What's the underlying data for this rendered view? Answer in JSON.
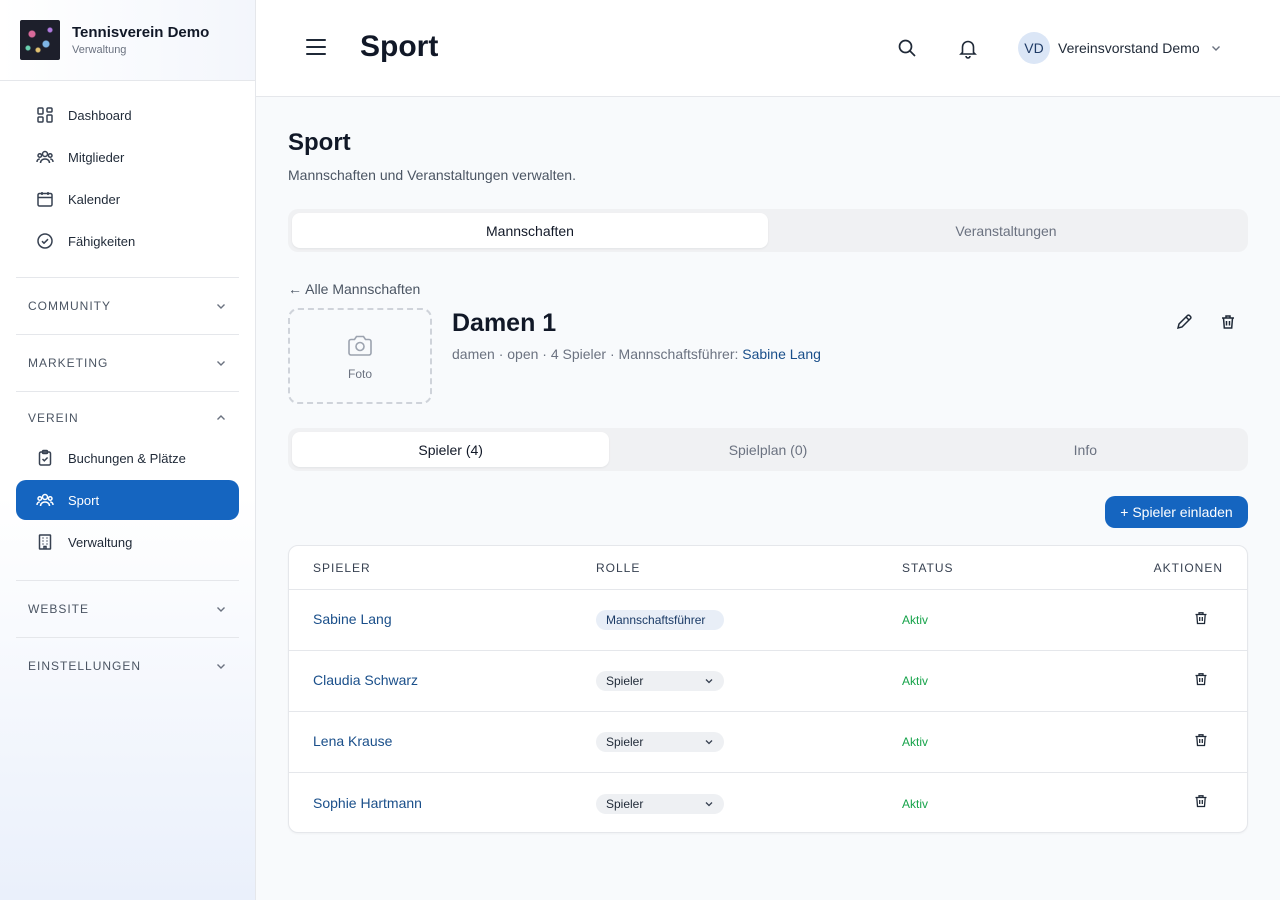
{
  "brand": {
    "name": "Tennisverein Demo",
    "subtitle": "Verwaltung"
  },
  "nav_main": [
    {
      "label": "Dashboard",
      "icon": "dashboard-icon"
    },
    {
      "label": "Mitglieder",
      "icon": "users-icon"
    },
    {
      "label": "Kalender",
      "icon": "calendar-icon"
    },
    {
      "label": "Fähigkeiten",
      "icon": "check-circle-icon"
    }
  ],
  "sections": {
    "community": "COMMUNITY",
    "marketing": "MARKETING",
    "verein": "VEREIN",
    "website": "WEBSITE",
    "einstellungen": "EINSTELLUNGEN"
  },
  "verein_items": [
    {
      "label": "Buchungen & Plätze",
      "icon": "clipboard-check-icon"
    },
    {
      "label": "Sport",
      "icon": "users-icon",
      "active": true
    },
    {
      "label": "Verwaltung",
      "icon": "building-icon"
    }
  ],
  "header": {
    "title": "Sport",
    "user_initials": "VD",
    "user_name": "Vereinsvorstand Demo"
  },
  "page": {
    "title": "Sport",
    "description": "Mannschaften und Veranstaltungen verwalten.",
    "tabs": [
      "Mannschaften",
      "Veranstaltungen"
    ],
    "active_tab": 0,
    "back_label": "← Alle Mannschaften"
  },
  "team": {
    "photo_label": "Foto",
    "name": "Damen 1",
    "meta_prefix": "damen · open · 4 Spieler · Mannschaftsführer: ",
    "captain": "Sabine Lang",
    "subtabs": [
      "Spieler (4)",
      "Spielplan (0)",
      "Info"
    ],
    "active_subtab": 0
  },
  "invite_button": "+ Spieler einladen",
  "table": {
    "headers": {
      "player": "SPIELER",
      "role": "ROLLE",
      "status": "STATUS",
      "actions": "AKTIONEN"
    },
    "rows": [
      {
        "player": "Sabine Lang",
        "role": "Mannschaftsführer",
        "status": "Aktiv"
      },
      {
        "player": "Claudia Schwarz",
        "role": "Spieler",
        "status": "Aktiv"
      },
      {
        "player": "Lena Krause",
        "role": "Spieler",
        "status": "Aktiv"
      },
      {
        "player": "Sophie Hartmann",
        "role": "Spieler",
        "status": "Aktiv"
      }
    ]
  },
  "colors": {
    "accent": "#1565c0",
    "link": "#1a4f8a",
    "status_active": "#16a34a"
  }
}
